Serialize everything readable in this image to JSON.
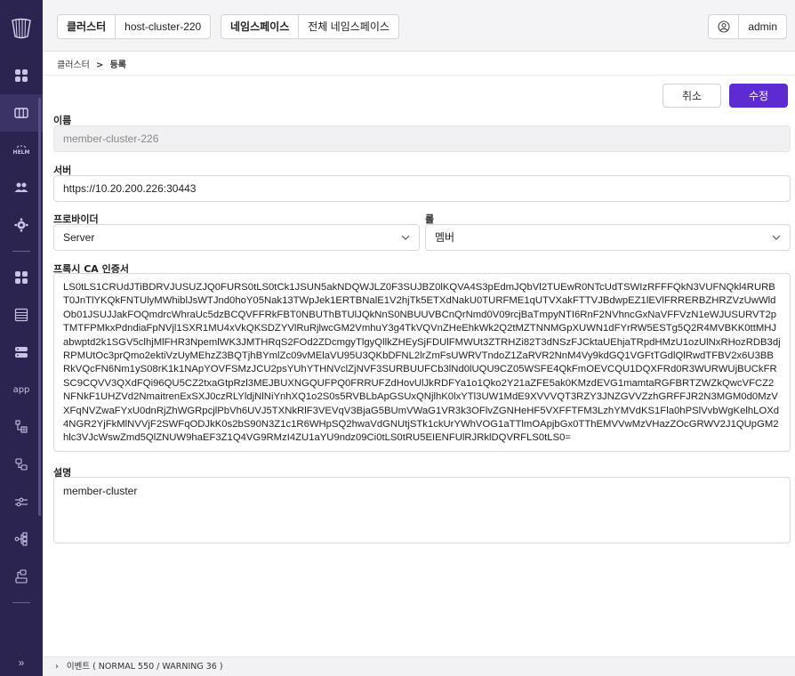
{
  "topbar": {
    "cluster_key": "클러스터",
    "cluster_value": "host-cluster-220",
    "namespace_key": "네임스페이스",
    "namespace_value": "전체 네임스페이스",
    "user": "admin"
  },
  "breadcrumb": {
    "parent": "클러스터",
    "separator": ">",
    "current": "등록"
  },
  "actions": {
    "cancel_label": "취소",
    "save_label": "수정"
  },
  "form": {
    "name_label": "이름",
    "name_value": "member-cluster-226",
    "server_label": "서버",
    "server_value": "https://10.20.200.226:30443",
    "provider_label": "프로바이더",
    "provider_value": "Server",
    "role_label": "롤",
    "role_value": "멤버",
    "ca_label": "프록시 CA 인증서",
    "ca_value": "LS0tLS1CRUdJTiBDRVJUSUZJQ0FURS0tLS0tCk1JSUN5akNDQWJLZ0F3SUJBZ0lKQVA4S3pEdmJQbVl2TUEwR0NTcUdTSWIzRFFFQkN3VUFNQkl4RURBT0JnTlYKQkFNTUlyMWhiblJsWTJnd0hoY05Nak13TWpJek1ERTBNalE1V2hjTk5ETXdNakU0TURFME1qUTVXakFTTVJBdwpEZ1lEVlFRRERBZHRZVzUwWldOb01JSUJJakFOQmdrcWhraUc5dzBCQVFFRkFBT0NBUThBTUlJQkNnS0NBUUVBCnQrNmd0V09rcjBaTmpyNTI6RnF2NVhncGxNaVFFVzN1eWJUSURVT2pTMTFPMkxPdndiaFpNVjl1SXR1MU4xVkQKSDZYVlRuRjlwcGM2VmhuY3g4TkVQVnZHeEhkWk2Q2tMZTNNMGpXUWN1dFYrRW5ESTg5Q2R4MVBKK0ttMHJabwptd2k1SGV5clhjMlFHR3NpemlWK3JMTHRqS2FOd2ZDcmgyTlgyQllkZHEySjFDUlFMWUt3ZTRHZi82T3dNSzFJCktaUEhjaTRpdHMzU1ozUlNxRHozRDB3djRPMUtOc3prQmo2ektiVzUyMEhzZ3BQTjhBYmlZc09vMElaVU95U3QKbDFNL2lrZmFsUWRVTndoZ1ZaRVR2NnM4Vy9kdGQ1VGFtTGdlQlRwdTFBV2x6U3BBRkVQcFN6Nm1yS08rK1k1NApYOVFSMzJCU2psYUhYTHNVclZjNVF3SURBUUFCb3lNd0lUQU9CZ05WSFE4QkFmOEVCQU1DQXFRd0R3WURWUjBUCkFRSC9CQVV3QXdFQi96QU5CZ2txaGtpRzl3MEJBUXNGQUFPQ0FRRUFZdHovUlJkRDFYa1o1Qko2Y21aZFE5ak0KMzdEVG1mamtaRGFBRTZWZkQwcVFCZ2NFNkF1UHZVd2NmaitrenExSXJ0czRLYldjNlNiYnhXQ1o2S0s5RVBLbApGSUxQNjlhK0lxYTl3UW1MdE9XVVVQT3RZY3JNZGVVZzhGRFFJR2N3MGM0d0MzVXFqNVZwaFYxU0dnRjZhWGRpcjlPbVh6UVJ5TXNkRlF3VEVqV3BjaG5BUmVWaG1VR3k3OFlvZGNHeHF5VXFFTFM3LzhYMVdKS1Fla0hPSlVvbWgKelhLOXd4NGR2YjFkMlNVVjF2SWFqODJkK0s2bS90N3Z1c1R6WHpSQ2hwaVdGNUtjSTk1ckUrYWhVOG1aTTlmOApjbGx0TThEMVVwMzVHazZOcGRWV2J1QUpGM2hlc3VJcWswZmd5QlZNUW9haEF3Z1Q4VG9RMzI4ZU1aYU9ndz09Ci0tLS0tRU5EIENFUlRJRklDQVRFLS0tLS0=",
    "desc_label": "설명",
    "desc_value": "member-cluster"
  },
  "eventbar": {
    "text": "이벤트 ( NORMAL 550 / WARNING 36 )"
  },
  "sidebar": {
    "app_label": "app"
  },
  "colors": {
    "sidebar_bg": "#2b2350",
    "primary": "#5e2bd2"
  }
}
